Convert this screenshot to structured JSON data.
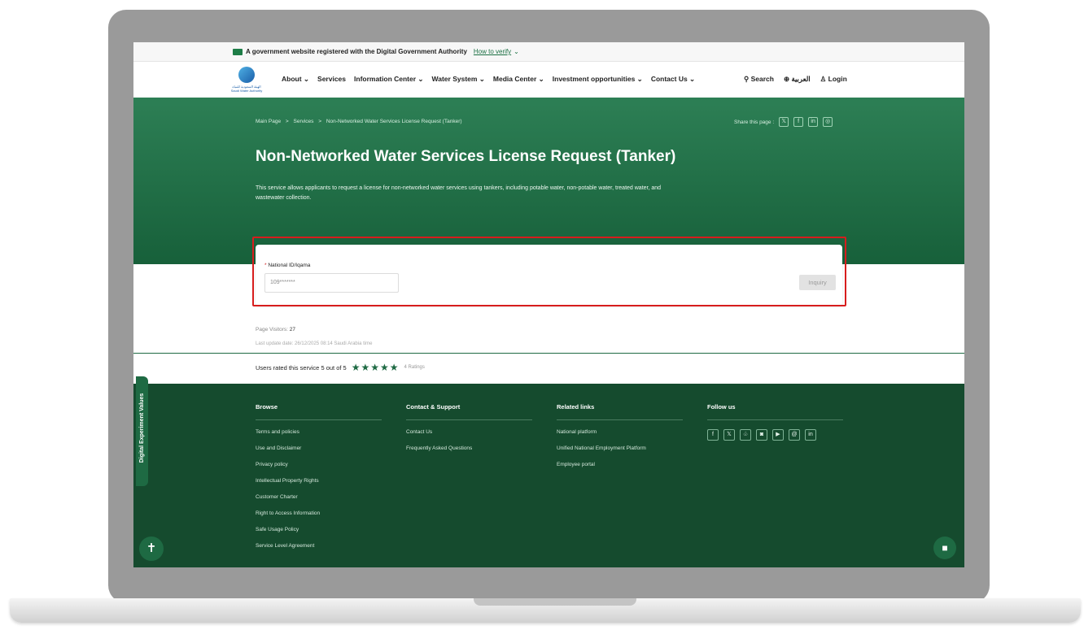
{
  "gov_bar": {
    "text": "A government website registered with the Digital Government Authority",
    "verify_link": "How to verify"
  },
  "logo": {
    "text": "الهيئة السعودية للمياه Saudi Water Authority"
  },
  "nav": {
    "items": [
      {
        "label": "About ⌄"
      },
      {
        "label": "Services"
      },
      {
        "label": "Information Center ⌄"
      },
      {
        "label": "Water System ⌄"
      },
      {
        "label": "Media Center ⌄"
      },
      {
        "label": "Investment opportunities ⌄"
      },
      {
        "label": "Contact Us ⌄"
      }
    ],
    "search": "Search",
    "language": "العربية",
    "login": "Login"
  },
  "breadcrumb": {
    "items": [
      "Main Page",
      "Services",
      "Non-Networked Water Services License Request (Tanker)"
    ],
    "separator": ">"
  },
  "share": {
    "label": "Share this page :"
  },
  "page": {
    "title": "Non-Networked Water Services License Request (Tanker)",
    "description": "This service allows applicants to request a license for non-networked water services using tankers, including potable water, non-potable water, treated water, and wastewater collection."
  },
  "form": {
    "required_mark": "*",
    "label": "National ID/Iqama",
    "value": "109*******",
    "button": "Inquiry"
  },
  "stats": {
    "visitors_label": "Page Visitors:",
    "visitors_count": "27",
    "last_update": "Last update date: 26/12/2025 08:14 Saudi Arabia time"
  },
  "rating": {
    "text": "Users rated this service 5 out of 5",
    "stars": "★★★★★",
    "count": "4 Ratings"
  },
  "footer": {
    "browse": {
      "title": "Browse",
      "links": [
        "Terms and policies",
        "Use and Disclaimer",
        "Privacy policy",
        "Intellectual Property Rights",
        "Customer Charter",
        "Right to Access Information",
        "Safe Usage Policy",
        "Service Level Agreement"
      ]
    },
    "contact": {
      "title": "Contact & Support",
      "links": [
        "Contact Us",
        "Frequently Asked Questions"
      ]
    },
    "related": {
      "title": "Related links",
      "links": [
        "National platform",
        "Unified National Employment Platform",
        "Employee portal"
      ]
    },
    "follow": {
      "title": "Follow us"
    }
  },
  "side_tab": {
    "label": "Digital Experiment Values"
  },
  "colors": {
    "brand_green": "#1e6a43",
    "footer_green": "#154b2e",
    "highlight_red": "#d71d1d"
  }
}
